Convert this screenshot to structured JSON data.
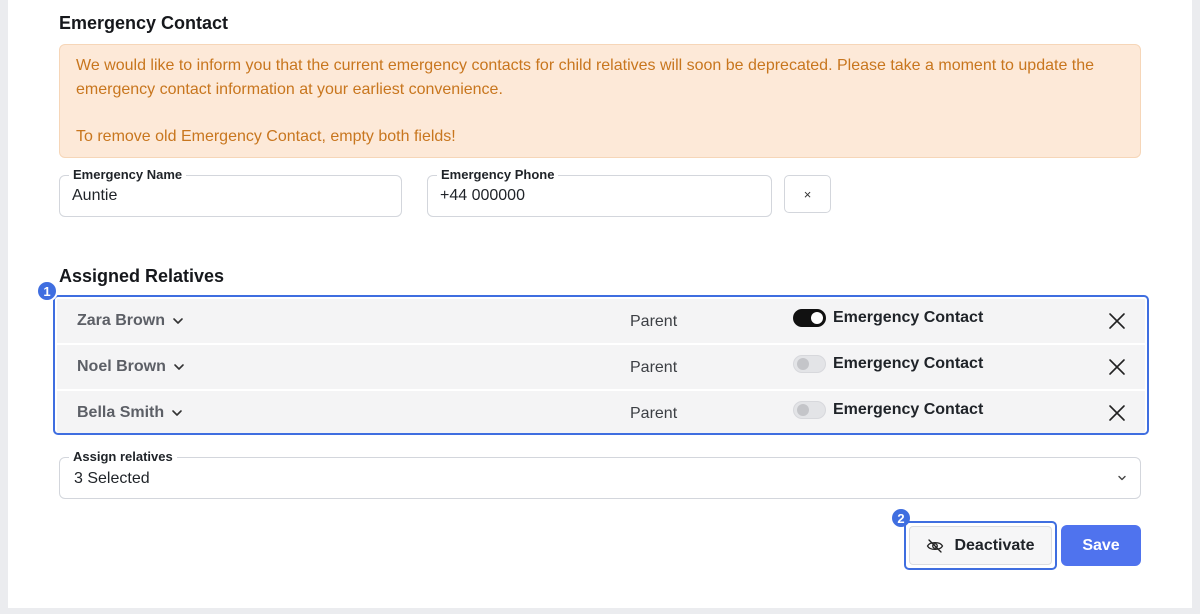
{
  "emergency": {
    "title": "Emergency Contact",
    "notice_line1": "We would like to inform you that the current emergency contacts for child relatives will soon be deprecated. Please take a moment to update the emergency contact information at your earliest convenience.",
    "notice_line2": "To remove old Emergency Contact, empty both fields!",
    "name_label": "Emergency Name",
    "name_value": "Auntie",
    "phone_label": "Emergency Phone",
    "phone_value": "+44 000000",
    "clear_label": "×"
  },
  "relatives": {
    "title": "Assigned Relatives",
    "badge": "1",
    "items": [
      {
        "name": "Zara Brown",
        "role": "Parent",
        "toggle_label": "Emergency Contact",
        "emergency": true
      },
      {
        "name": "Noel Brown",
        "role": "Parent",
        "toggle_label": "Emergency Contact",
        "emergency": false
      },
      {
        "name": "Bella Smith",
        "role": "Parent",
        "toggle_label": "Emergency Contact",
        "emergency": false
      }
    ]
  },
  "assign": {
    "label": "Assign relatives",
    "value": "3 Selected"
  },
  "actions": {
    "badge": "2",
    "deactivate_label": "Deactivate",
    "save_label": "Save"
  },
  "icons": {
    "row_chevron": "chevron-down-icon",
    "remove": "close-icon",
    "deactivate": "eye-off-icon",
    "dropdown": "chevron-down-icon"
  },
  "colors": {
    "accent": "#3f6ee0",
    "save": "#4f73ee",
    "notice_bg": "#fde9d8",
    "notice_text": "#c8761e"
  }
}
